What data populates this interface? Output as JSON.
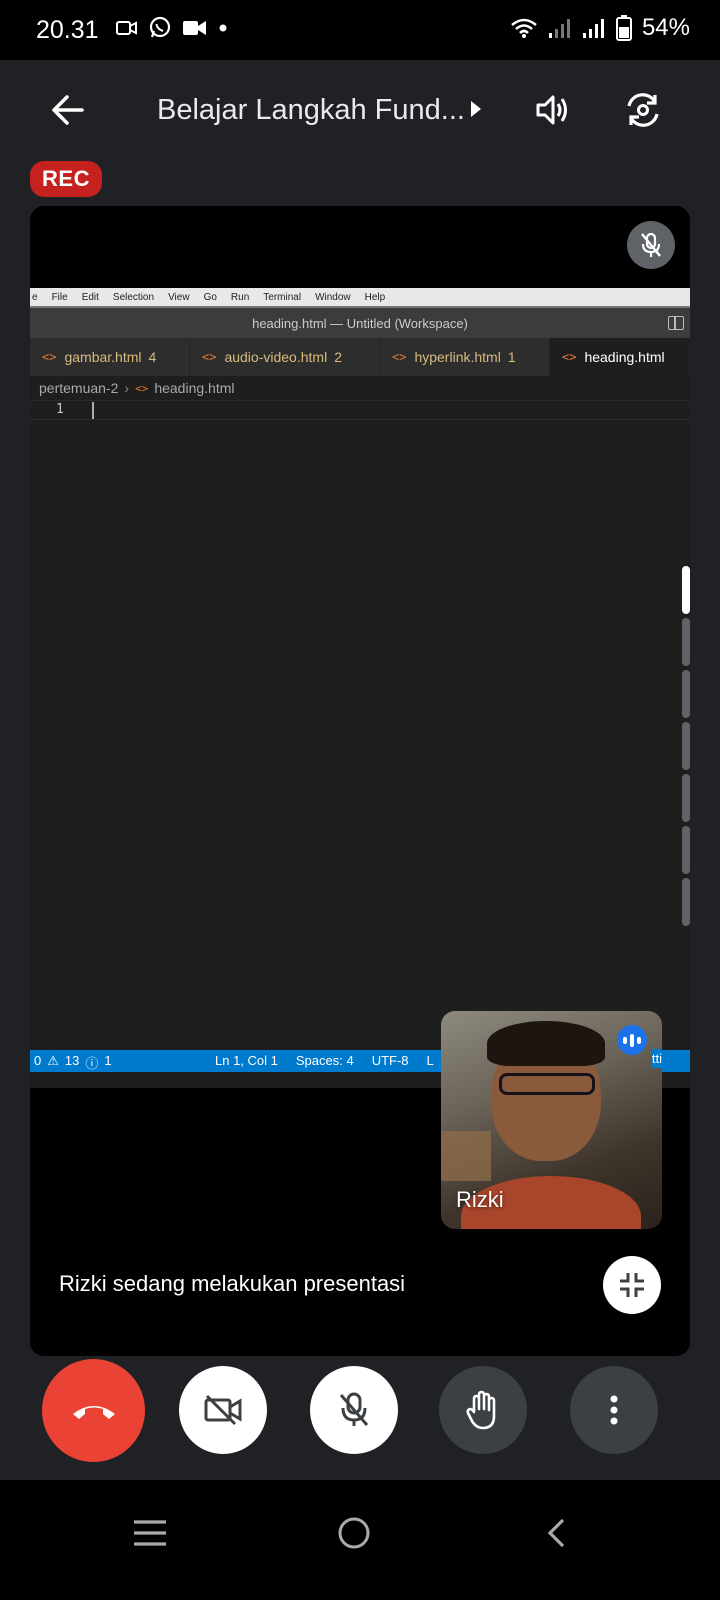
{
  "status_bar": {
    "time": "20.31",
    "battery": "54%"
  },
  "topbar": {
    "title": "Belajar Langkah Fund..."
  },
  "rec_label": "REC",
  "vscode": {
    "menu": [
      "e",
      "File",
      "Edit",
      "Selection",
      "View",
      "Go",
      "Run",
      "Terminal",
      "Window",
      "Help"
    ],
    "window_title": "heading.html — Untitled (Workspace)",
    "tabs": [
      {
        "name": "gambar.html",
        "badge": "4"
      },
      {
        "name": "audio-video.html",
        "badge": "2"
      },
      {
        "name": "hyperlink.html",
        "badge": "1"
      },
      {
        "name": "heading.html",
        "badge": ""
      }
    ],
    "breadcrumb": {
      "folder": "pertemuan-2",
      "file": "heading.html"
    },
    "line_number": "1",
    "status": {
      "errors": "0",
      "warnings": "13",
      "info": "1",
      "position": "Ln 1, Col 1",
      "spaces": "Spaces: 4",
      "encoding": "UTF-8",
      "eol": "L",
      "tail": "tti"
    }
  },
  "self_view": {
    "name": "Rizki"
  },
  "presenting_text": "Rizki sedang melakukan presentasi",
  "colors": {
    "end_call": "#ea4335",
    "rec": "#c5221f",
    "vscode_status": "#007acc",
    "speaking": "#1a73e8"
  },
  "icons": {
    "back": "arrow-back-icon",
    "speaker": "volume-icon",
    "switch_camera": "switch-camera-icon",
    "end_call": "phone-hangup-icon",
    "camera_off": "camera-off-icon",
    "mic_off": "mic-off-icon",
    "raise_hand": "hand-icon",
    "more": "more-vert-icon"
  }
}
